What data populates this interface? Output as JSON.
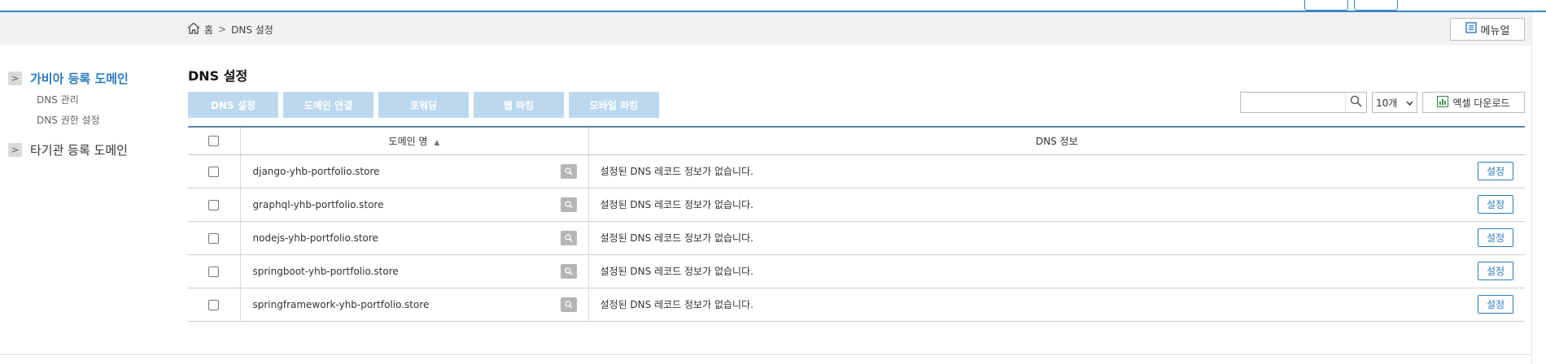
{
  "breadcrumb": {
    "home_label": "홈",
    "separator": ">",
    "current": "DNS 설정"
  },
  "manual_button": "메뉴얼",
  "sidebar": {
    "groups": [
      {
        "label": "가비아 등록 도메인",
        "arrow": ">",
        "items": [
          "DNS 관리",
          "DNS 권한 설정"
        ]
      },
      {
        "label": "타기관 등록 도메인",
        "arrow": ">"
      }
    ]
  },
  "page_title": "DNS 설정",
  "tabs": [
    "DNS 설정",
    "도메인 연결",
    "포워딩",
    "웹 파킹",
    "모바일 파킹"
  ],
  "toolbar": {
    "search_value": "",
    "page_size": "10개",
    "excel_label": "엑셀 다운로드"
  },
  "table": {
    "columns": {
      "domain": "도메인 명",
      "sort": "▲",
      "dns": "DNS 정보"
    },
    "rows": [
      {
        "domain": "django-yhb-portfolio.store",
        "dns": "설정된 DNS 레코드 정보가 없습니다.",
        "action": "설정"
      },
      {
        "domain": "graphql-yhb-portfolio.store",
        "dns": "설정된 DNS 레코드 정보가 없습니다.",
        "action": "설정"
      },
      {
        "domain": "nodejs-yhb-portfolio.store",
        "dns": "설정된 DNS 레코드 정보가 없습니다.",
        "action": "설정"
      },
      {
        "domain": "springboot-yhb-portfolio.store",
        "dns": "설정된 DNS 레코드 정보가 없습니다.",
        "action": "설정"
      },
      {
        "domain": "springframework-yhb-portfolio.store",
        "dns": "설정된 DNS 레코드 정보가 없습니다.",
        "action": "설정"
      }
    ]
  },
  "colors": {
    "accent": "#2a7ac0",
    "tab_bg": "#bcd8ef",
    "header_border": "#5a7fa3"
  },
  "icons": {
    "home": "home-icon",
    "manual": "document-icon",
    "search": "search-icon",
    "excel": "excel-icon",
    "row_search": "magnifier-icon"
  }
}
